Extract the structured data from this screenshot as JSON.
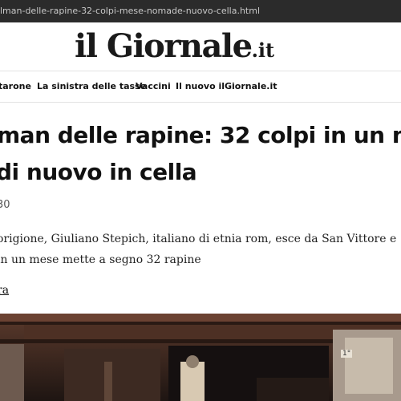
{
  "browser": {
    "url": "lman-delle-rapine-32-colpi-mese-nomade-nuovo-cella.html"
  },
  "header": {
    "logo_main": "il Giornale",
    "logo_tld": ".it"
  },
  "nav": {
    "items": [
      "tarone",
      "La sinistra delle tasse",
      "Vaccini",
      "Il nuovo ilGiornale.it"
    ]
  },
  "article": {
    "headline_lines": [
      "man delle rapine: 32 colpi in un m",
      "di nuovo in cella"
    ],
    "date": "30",
    "summary_lines": [
      "origione, Giuliano Stepich, italiano di etnia rom, esce da San Vittore e",
      "in un mese mette a segno 32 rapine"
    ],
    "read_more": "ra"
  },
  "photo": {
    "label": "1°"
  }
}
